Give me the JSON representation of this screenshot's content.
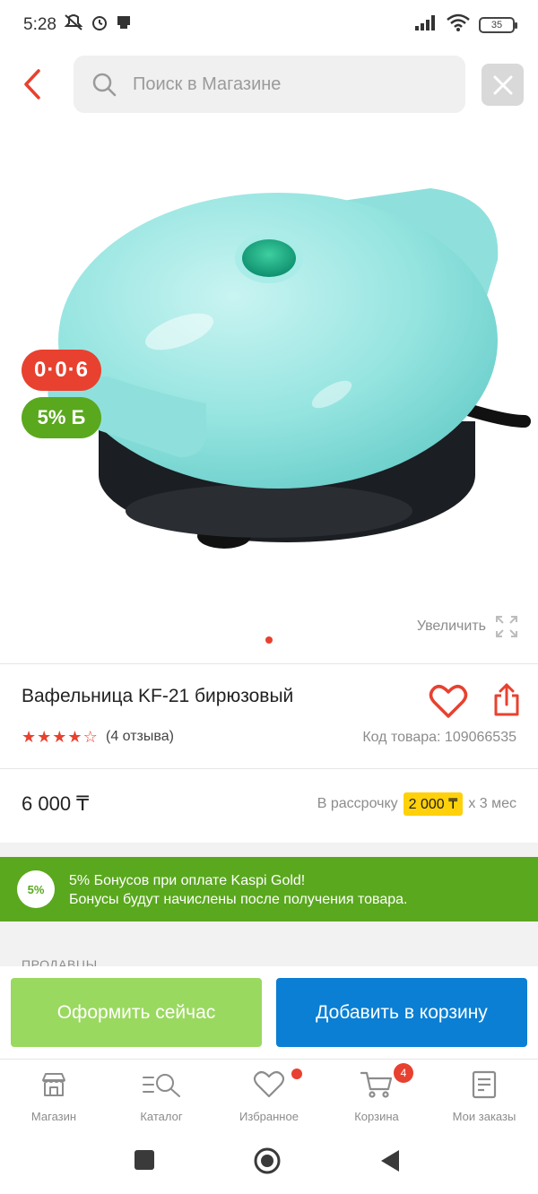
{
  "status_bar": {
    "time": "5:28",
    "battery": "35"
  },
  "header": {
    "search_placeholder": "Поиск в Магазине"
  },
  "product": {
    "badge_installment": "0·0·6",
    "badge_bonus": "5%",
    "badge_bonus_currency": "Б",
    "zoom_label": "Увеличить",
    "title": "Вафельница KF-21 бирюзовый",
    "rating": 4,
    "reviews": "(4 отзыва)",
    "sku": "Код товара: 109066535",
    "price": "6 000 ₸",
    "installment_prefix": "В рассрочку",
    "installment_amount": "2 000 ₸",
    "installment_suffix": "х 3 мес"
  },
  "bonus_banner": {
    "badge": "5%",
    "line1": "5% Бонусов при оплате Kaspi Gold!",
    "line2": "Бонусы будут начислены после получения товара."
  },
  "sellers": {
    "label": "ПРОДАВЦЫ"
  },
  "actions": {
    "buy_now": "Оформить сейчас",
    "add_to_cart": "Добавить в корзину"
  },
  "bottom_nav": {
    "shop": "Магазин",
    "catalog": "Каталог",
    "favorites": "Избранное",
    "cart": "Корзина",
    "cart_count": "4",
    "orders": "Мои заказы"
  },
  "colors": {
    "accent_red": "#e8412f",
    "kaspi_green": "#5aa81e",
    "cart_blue": "#0a7fd4",
    "buy_green": "#9ad95f",
    "highlight_yellow": "#ffd10a"
  }
}
